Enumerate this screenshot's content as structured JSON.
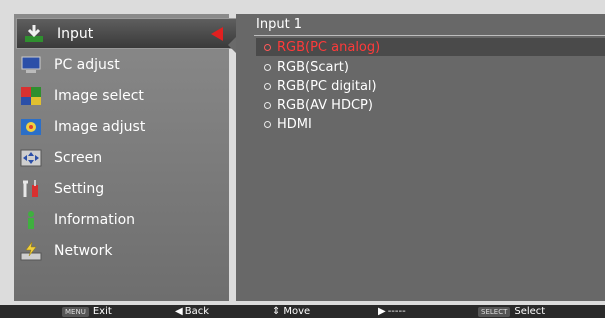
{
  "menu": {
    "items": [
      {
        "label": "Input",
        "icon": "input-icon",
        "selected": true
      },
      {
        "label": "PC adjust",
        "icon": "pc-adjust-icon"
      },
      {
        "label": "Image select",
        "icon": "image-select-icon"
      },
      {
        "label": "Image adjust",
        "icon": "image-adjust-icon"
      },
      {
        "label": "Screen",
        "icon": "screen-icon"
      },
      {
        "label": "Setting",
        "icon": "setting-icon"
      },
      {
        "label": "Information",
        "icon": "information-icon"
      },
      {
        "label": "Network",
        "icon": "network-icon"
      }
    ]
  },
  "submenu": {
    "title": "Input 1",
    "options": [
      {
        "label": "RGB(PC analog)",
        "selected": true
      },
      {
        "label": "RGB(Scart)"
      },
      {
        "label": "RGB(PC digital)"
      },
      {
        "label": "RGB(AV HDCP)"
      },
      {
        "label": "HDMI"
      }
    ]
  },
  "footer": {
    "exit_key": "MENU",
    "exit_label": "Exit",
    "back_arrow": "◀",
    "back_label": "Back",
    "move_arrow": "⇕",
    "move_label": "Move",
    "next_arrow": "▶",
    "next_label": "-----",
    "select_key": "SELECT",
    "select_label": "Select"
  },
  "colors": {
    "accent": "#e22020",
    "panel": "#686868",
    "footer": "#2a2a2a"
  }
}
